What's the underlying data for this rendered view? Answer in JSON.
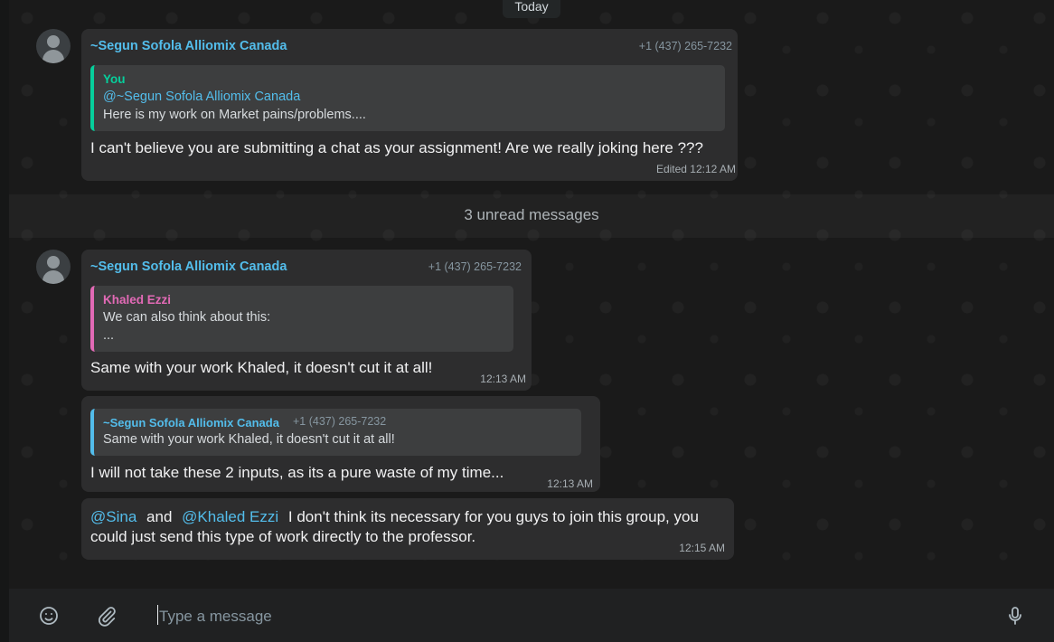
{
  "date_pill": "Today",
  "unread_divider": "3 unread messages",
  "messages": [
    {
      "sender": "~Segun Sofola Alliomix Canada",
      "phone": "+1 (437) 265-7232",
      "quote": {
        "author": "You",
        "line1": "@~Segun Sofola Alliomix Canada",
        "line2": "Here is my work on Market pains/problems...."
      },
      "text": "I can't believe you are submitting a chat as your assignment! Are we really joking here ???",
      "time": "Edited 12:12 AM"
    },
    {
      "sender": "~Segun Sofola Alliomix Canada",
      "phone": "+1 (437) 265-7232",
      "quote": {
        "author": "Khaled Ezzi",
        "line1": "We can also think about this:",
        "line2": "..."
      },
      "text": "Same with your work Khaled, it doesn't cut it at all!",
      "time": "12:13 AM"
    },
    {
      "quote": {
        "author": "~Segun Sofola Alliomix Canada",
        "phone": "+1 (437) 265-7232",
        "line1": "Same with your work Khaled, it doesn't cut it at all!"
      },
      "text": "I will not take these 2 inputs, as its a pure waste of my time...",
      "time": "12:13 AM"
    },
    {
      "mention1": "@Sina",
      "and": "and",
      "mention2": "@Khaled Ezzi",
      "text_rest": "I don't think its necessary for you guys to join this group, you",
      "text_line2": "could just send this type of work directly to the professor.",
      "time": "12:15 AM"
    }
  ],
  "composer": {
    "placeholder": "Type a message",
    "emoji_icon": "emoji-icon",
    "attach_icon": "paperclip-icon",
    "mic_icon": "microphone-icon"
  },
  "colors": {
    "sender": "#53bdeb",
    "quote_you": "#06cf9c",
    "quote_khaled": "#e26ab6",
    "quote_segun": "#53bdeb",
    "bubble": "#2d2d2e"
  }
}
